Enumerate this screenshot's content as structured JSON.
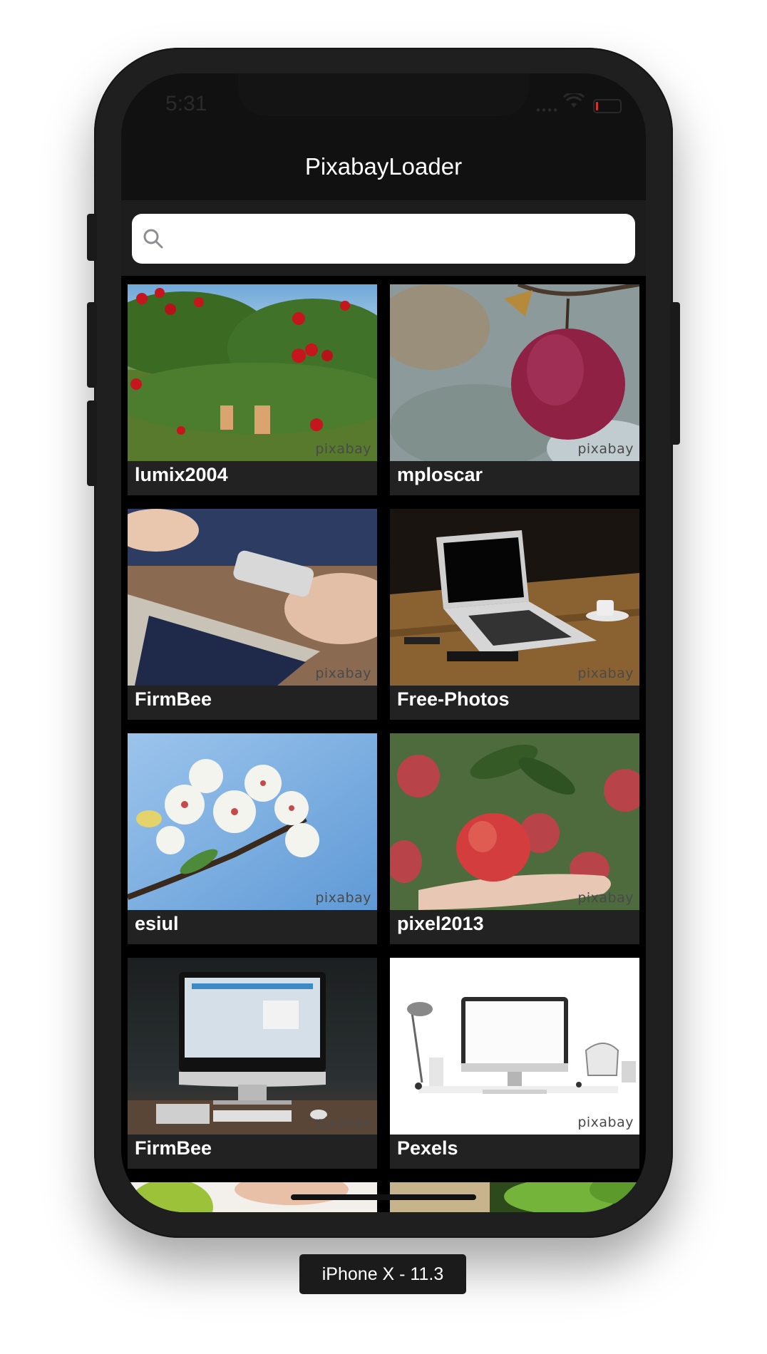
{
  "status_bar": {
    "time": "5:31"
  },
  "nav": {
    "title": "PixabayLoader"
  },
  "search": {
    "placeholder": "",
    "value": ""
  },
  "watermark": "pixabay",
  "photos": [
    {
      "user": "lumix2004",
      "subject": "apple orchard"
    },
    {
      "user": "mploscar",
      "subject": "red apple on branch"
    },
    {
      "user": "FirmBee",
      "subject": "hands with smartphone and laptop"
    },
    {
      "user": "Free-Photos",
      "subject": "laptop on wooden desk"
    },
    {
      "user": "esiul",
      "subject": "white blossoms"
    },
    {
      "user": "pixel2013",
      "subject": "apple in hand"
    },
    {
      "user": "FirmBee",
      "subject": "desktop computer"
    },
    {
      "user": "Pexels",
      "subject": "white workspace with monitor"
    }
  ],
  "device_label": "iPhone X - 11.3"
}
